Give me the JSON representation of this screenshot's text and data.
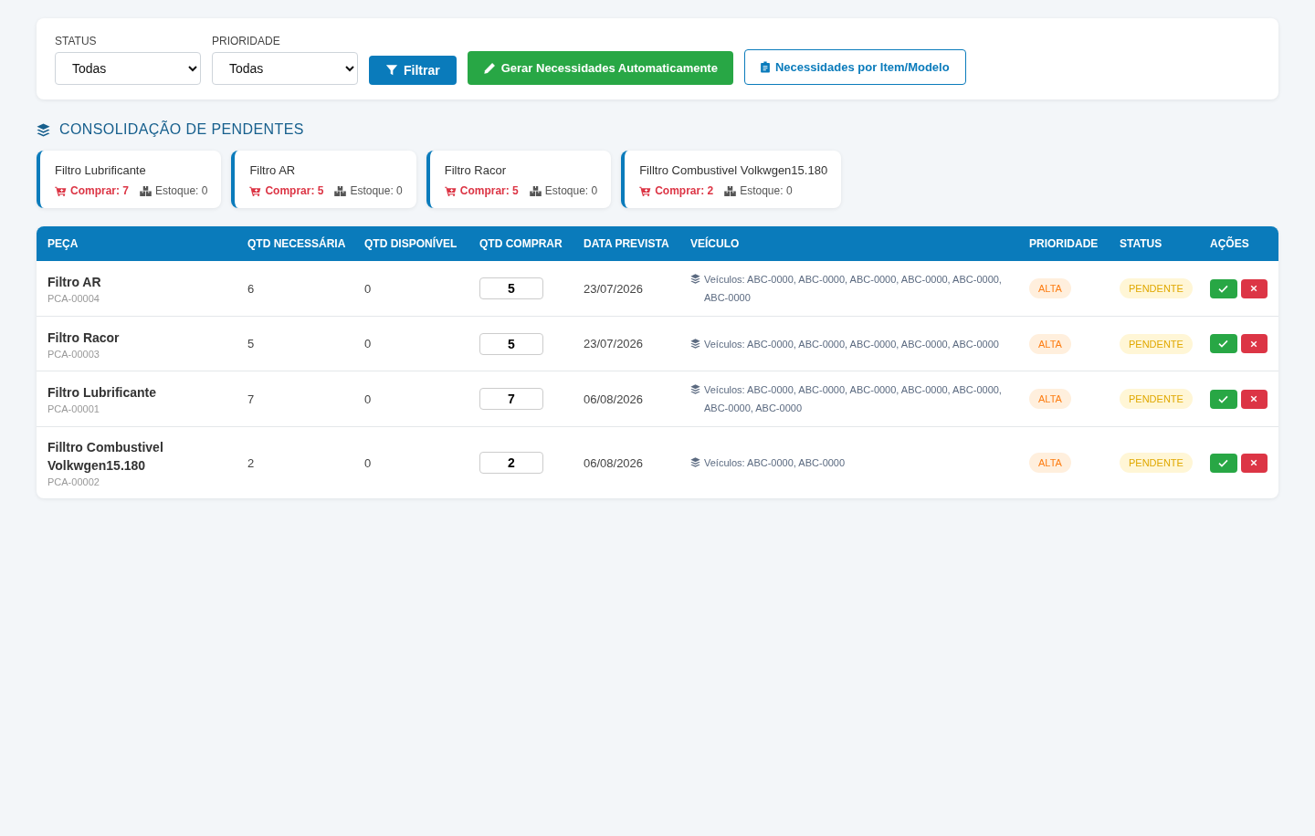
{
  "filters": [
    {
      "label": "STATUS",
      "value": "Todas"
    },
    {
      "label": "PRIORIDADE",
      "value": "Todas"
    }
  ],
  "buttons": [
    {
      "kind": "filter",
      "label": "Filtrar"
    },
    {
      "kind": "generate",
      "label": "Gerar Necessidades Automaticamente"
    },
    {
      "kind": "by-item",
      "label": "Necessidades por Item/Modelo"
    }
  ],
  "section_title": "CONSOLIDAÇÃO DE PENDENTES",
  "summary_cards": [
    {
      "name": "Filtro Lubrificante",
      "buy": "Comprar: 7",
      "stock": "Estoque: 0"
    },
    {
      "name": "Filtro AR",
      "buy": "Comprar: 5",
      "stock": "Estoque: 0"
    },
    {
      "name": "Filtro Racor",
      "buy": "Comprar: 5",
      "stock": "Estoque: 0"
    },
    {
      "name": "Filltro Combustivel Volkwgen15.180",
      "buy": "Comprar: 2",
      "stock": "Estoque: 0"
    }
  ],
  "table": {
    "columns": [
      "PEÇA",
      "QTD NECESSÁRIA",
      "QTD DISPONÍVEL",
      "QTD COMPRAR",
      "DATA PREVISTA",
      "VEÍCULO",
      "PRIORIDADE",
      "STATUS",
      "AÇÕES"
    ],
    "rows": [
      {
        "part": "Filtro AR",
        "code": "PCA-00004",
        "qty_needed": "6",
        "qty_available": "0",
        "qty_buy": "5",
        "date": "23/07/2026",
        "vehicles": "Veículos: ABC-0000, ABC-0000, ABC-0000, ABC-0000, ABC-0000, ABC-0000",
        "priority": {
          "label": "ALTA",
          "kind": "high"
        },
        "status": {
          "label": "PENDENTE",
          "kind": "pending"
        }
      },
      {
        "part": "Filtro Racor",
        "code": "PCA-00003",
        "qty_needed": "5",
        "qty_available": "0",
        "qty_buy": "5",
        "date": "23/07/2026",
        "vehicles": "Veículos: ABC-0000, ABC-0000, ABC-0000, ABC-0000, ABC-0000",
        "priority": {
          "label": "ALTA",
          "kind": "high"
        },
        "status": {
          "label": "PENDENTE",
          "kind": "pending"
        }
      },
      {
        "part": "Filtro Lubrificante",
        "code": "PCA-00001",
        "qty_needed": "7",
        "qty_available": "0",
        "qty_buy": "7",
        "date": "06/08/2026",
        "vehicles": "Veículos: ABC-0000, ABC-0000, ABC-0000, ABC-0000, ABC-0000, ABC-0000, ABC-0000",
        "priority": {
          "label": "ALTA",
          "kind": "high"
        },
        "status": {
          "label": "PENDENTE",
          "kind": "pending"
        }
      },
      {
        "part": "Filltro Combustivel Volkwgen15.180",
        "code": "PCA-00002",
        "qty_needed": "2",
        "qty_available": "0",
        "qty_buy": "2",
        "date": "06/08/2026",
        "vehicles": "Veículos: ABC-0000, ABC-0000",
        "priority": {
          "label": "ALTA",
          "kind": "high"
        },
        "status": {
          "label": "PENDENTE",
          "kind": "pending"
        }
      }
    ]
  }
}
